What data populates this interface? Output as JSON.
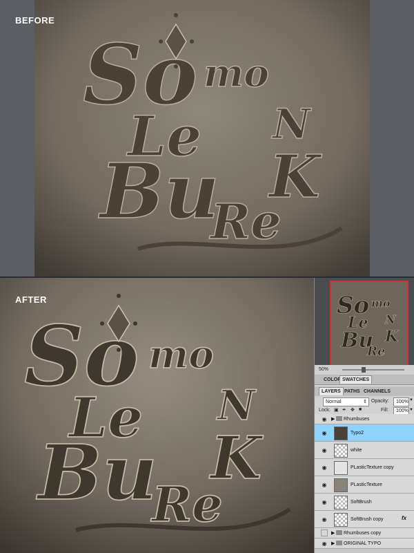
{
  "labels": {
    "before": "BEFORE",
    "after": "AFTER"
  },
  "artwork": {
    "lines": [
      "So",
      "mo",
      "Le",
      "N",
      "Bu",
      "K",
      "Re"
    ],
    "colors": {
      "paper": "#8a8276",
      "paper_dark": "#3a352f",
      "letter": "#4a4237",
      "letter_edge": "#b9ae9a"
    }
  },
  "panel": {
    "navigator_tabs": [
      "COLOR",
      "SWATCHES"
    ],
    "zoom": "50%",
    "layer_tabs": [
      "LAYERS",
      "PATHS",
      "CHANNELS"
    ],
    "blend_mode": "Normal",
    "opacity_label": "Opacity:",
    "opacity_value": "100%",
    "lock_label": "Lock:",
    "fill_label": "Fill:",
    "fill_value": "100%",
    "fx_label": "fx",
    "layers": [
      {
        "name": "Rhumbuses",
        "type": "folder",
        "visible": true
      },
      {
        "name": "Typo2",
        "type": "layer",
        "visible": true,
        "selected": true
      },
      {
        "name": "white",
        "type": "layer",
        "visible": true
      },
      {
        "name": "PLasticTexture copy",
        "type": "layer",
        "visible": true
      },
      {
        "name": "PLasticTexture",
        "type": "layer",
        "visible": true
      },
      {
        "name": "SoftBrush",
        "type": "layer",
        "visible": true
      },
      {
        "name": "SoftBrush copy",
        "type": "layer",
        "visible": true,
        "fx": true
      },
      {
        "name": "Rhumbuses copy",
        "type": "folder",
        "visible": false
      },
      {
        "name": "ORIGINAL TYPO",
        "type": "folder",
        "visible": true
      }
    ]
  }
}
